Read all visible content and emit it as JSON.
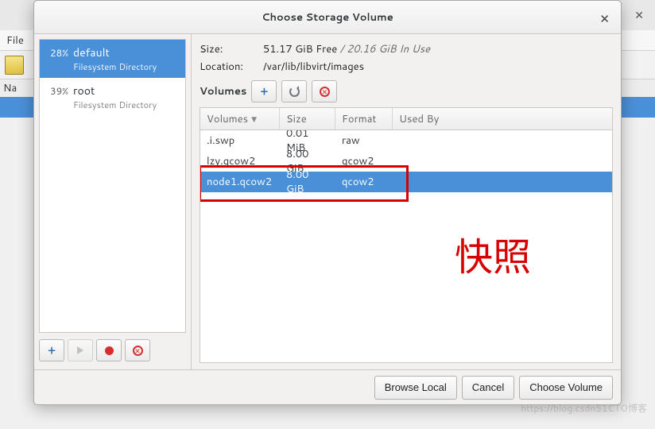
{
  "background": {
    "menu_label": "File",
    "left_label": "Na"
  },
  "dialog": {
    "title": "Choose Storage Volume"
  },
  "pools": [
    {
      "percent": "28%",
      "name": "default",
      "subtitle": "Filesystem Directory",
      "selected": true
    },
    {
      "percent": "39%",
      "name": "root",
      "subtitle": "Filesystem Directory",
      "selected": false
    }
  ],
  "info": {
    "size_label": "Size:",
    "size_free": "51.17 GiB Free",
    "size_used": "20.16 GiB In Use",
    "location_label": "Location:",
    "location_value": "/var/lib/libvirt/images",
    "volumes_label": "Volumes"
  },
  "columns": {
    "name": "Volumes",
    "size": "Size",
    "format": "Format",
    "used_by": "Used By"
  },
  "volumes": [
    {
      "name": ".i.swp",
      "size": "0.01 MiB",
      "format": "raw",
      "used_by": "",
      "selected": false
    },
    {
      "name": "lzy.qcow2",
      "size": "8.00 GiB",
      "format": "qcow2",
      "used_by": "",
      "selected": false
    },
    {
      "name": "node1.qcow2",
      "size": "8.00 GiB",
      "format": "qcow2",
      "used_by": "",
      "selected": true
    }
  ],
  "annotation_text": "快照",
  "footer": {
    "browse": "Browse Local",
    "cancel": "Cancel",
    "choose": "Choose Volume"
  },
  "watermark": "https://blog.csdn51CTO博客"
}
